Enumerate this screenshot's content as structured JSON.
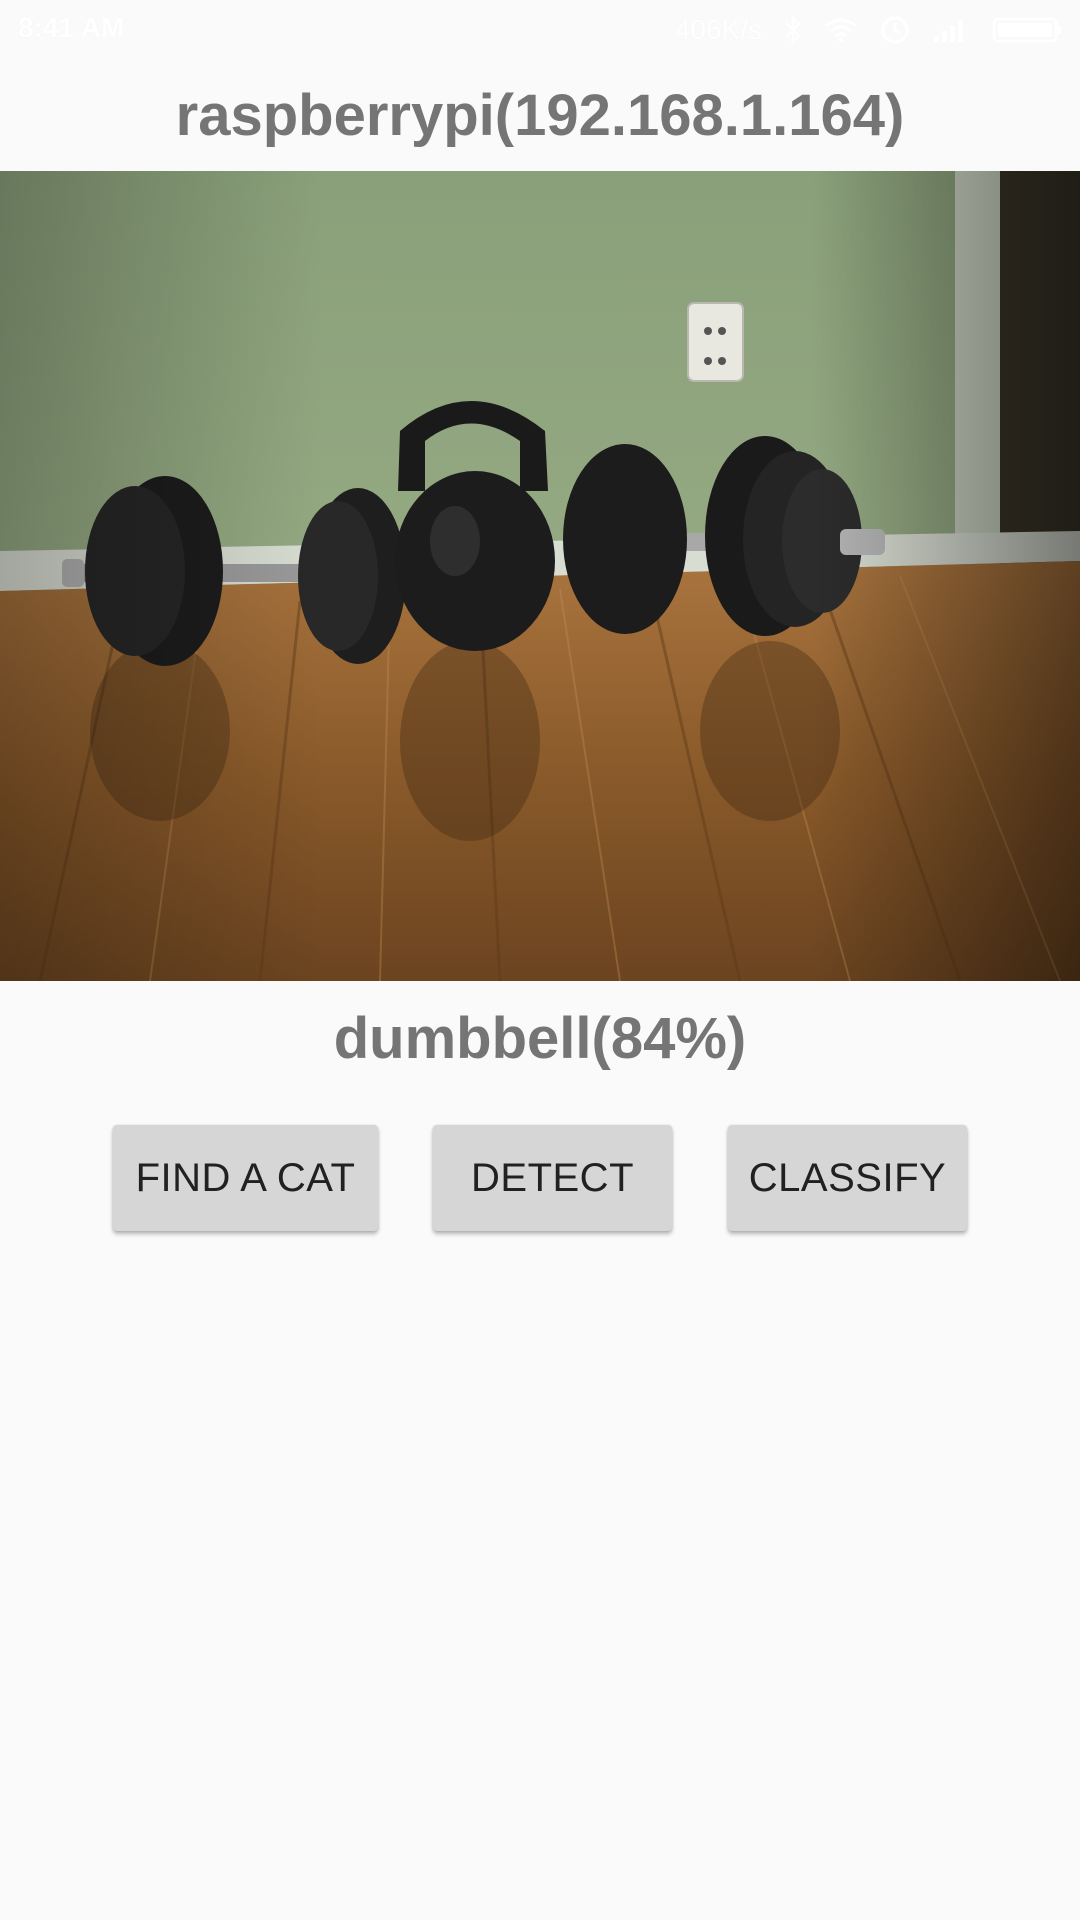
{
  "status_bar": {
    "time": "8:41 AM",
    "net_speed": "406K/s",
    "icons": [
      "bluetooth-icon",
      "wifi-icon",
      "alarm-icon",
      "signal-icon",
      "battery-icon"
    ]
  },
  "header": {
    "title": "raspberrypi(192.168.1.164)"
  },
  "photo": {
    "subject": "dumbbells-and-kettlebell"
  },
  "result": {
    "text": "dumbbell(84%)"
  },
  "buttons": {
    "find_cat": "FIND A CAT",
    "detect": "DETECT",
    "classify": "CLASSIFY"
  },
  "colors": {
    "background": "#fafafa",
    "title_text": "#757575",
    "button_bg": "#d6d6d6",
    "button_text": "#212121"
  }
}
